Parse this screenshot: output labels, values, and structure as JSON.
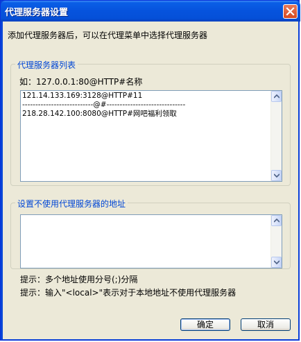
{
  "window": {
    "title": "代理服务器设置"
  },
  "description": "添加代理服务器后，可以在代理菜单中选择代理服务器",
  "proxy_list": {
    "legend": "代理服务器列表",
    "example": "如：127.0.0.1:80@HTTP#名称",
    "lines": [
      "121.14.133.169:3128@HTTP#11",
      "---------------------------@#------------------------------",
      "218.28.142.100:8080@HTTP#网吧福利领取"
    ]
  },
  "bypass": {
    "legend": "设置不使用代理服务器的地址",
    "value": ""
  },
  "hints": {
    "separator": "提示：多个地址使用分号(;)分隔",
    "local": "提示：输入\"<local>\"表示对于本地地址不使用代理服务器"
  },
  "buttons": {
    "ok": "确定",
    "cancel": "取消"
  },
  "colors": {
    "titlebar": "#0653dd",
    "dialog_bg": "#ece9d8",
    "legend_text": "#0046d5"
  },
  "icons": {
    "close": "close-icon",
    "scroll_up": "arrow-up-icon",
    "scroll_down": "arrow-down-icon"
  }
}
